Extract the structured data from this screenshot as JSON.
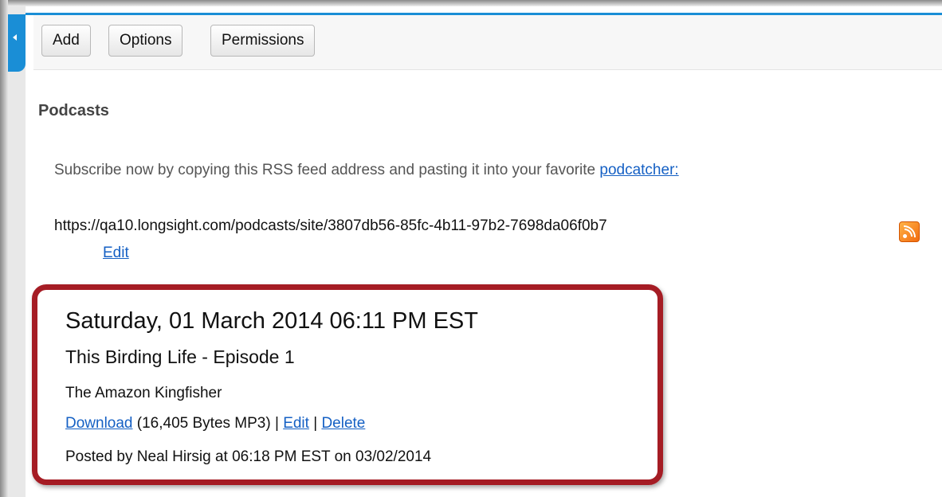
{
  "toolbar": {
    "add_label": "Add",
    "options_label": "Options",
    "permissions_label": "Permissions"
  },
  "page": {
    "title": "Podcasts",
    "subscribe_text": "Subscribe now by copying this RSS feed address and pasting it into your favorite ",
    "podcatcher_link": "podcatcher:",
    "feed_url": "https://qa10.longsight.com/podcasts/site/3807db56-85fc-4b11-97b2-7698da06f0b7",
    "feed_edit_label": "Edit",
    "rss_icon": "rss-feed-icon"
  },
  "episode": {
    "date": "Saturday, 01 March 2014 06:11 PM EST",
    "title": "This Birding Life - Episode 1",
    "description": "The Amazon Kingfisher",
    "download_label": "Download",
    "file_info": " (16,405 Bytes MP3) | ",
    "edit_label": "Edit",
    "separator": " | ",
    "delete_label": "Delete",
    "posted_by": "Posted by Neal Hirsig at 06:18 PM EST on 03/02/2014"
  },
  "colors": {
    "accent": "#1a8ed6",
    "highlight": "#a51c24",
    "link": "#1560c4"
  }
}
